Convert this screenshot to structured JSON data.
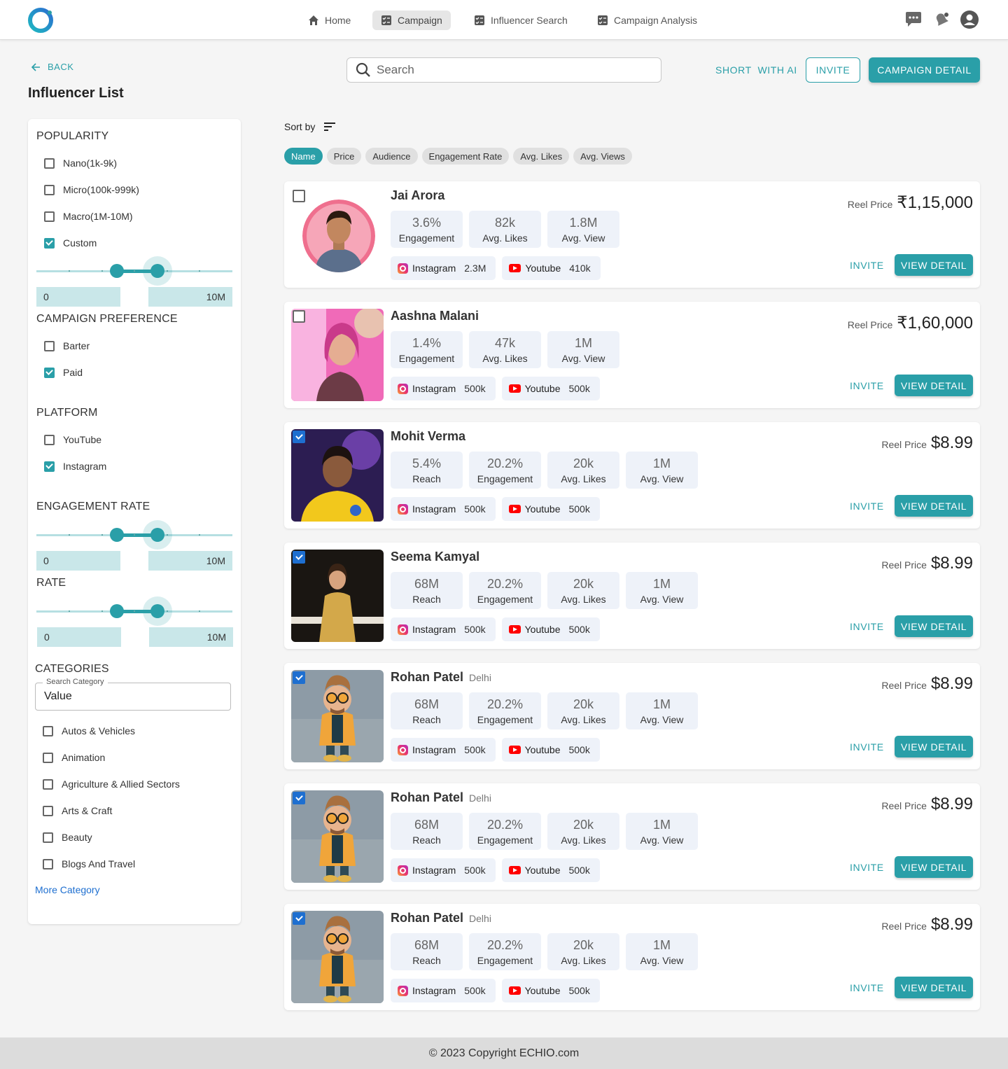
{
  "nav": {
    "items": [
      {
        "label": "Home",
        "icon": "home-icon"
      },
      {
        "label": "Campaign",
        "icon": "checklist-icon",
        "active": true
      },
      {
        "label": "Influencer Search",
        "icon": "checklist-icon"
      },
      {
        "label": "Campaign Analysis",
        "icon": "checklist-icon"
      }
    ]
  },
  "colors": {
    "accent": "#2a9fa8",
    "checkbox_blue": "#1e6fd0"
  },
  "back_label": "BACK",
  "page_title": "Influencer List",
  "search": {
    "placeholder": "Search"
  },
  "actions": {
    "short_ai": "SHORT  WITH AI",
    "invite": "INVITE",
    "campaign_detail": "CAMPAIGN DETAIL"
  },
  "filters": {
    "popularity": {
      "title": "POPULARITY",
      "options": [
        {
          "label": "Nano(1k-9k)",
          "checked": false
        },
        {
          "label": "Micro(100k-999k)",
          "checked": false
        },
        {
          "label": "Macro(1M-10M)",
          "checked": false
        },
        {
          "label": "Custom",
          "checked": true
        }
      ],
      "min": "0",
      "max": "10M"
    },
    "campaign_preference": {
      "title": "CAMPAIGN PREFERENCE",
      "options": [
        {
          "label": "Barter",
          "checked": false
        },
        {
          "label": "Paid",
          "checked": true
        }
      ]
    },
    "platform": {
      "title": "PLATFORM",
      "options": [
        {
          "label": "YouTube",
          "checked": false
        },
        {
          "label": "Instagram",
          "checked": true
        }
      ]
    },
    "engagement_rate": {
      "title": "ENGAGEMENT RATE",
      "min": "0",
      "max": "10M"
    },
    "rate": {
      "title": "RATE",
      "min": "0",
      "max": "10M"
    },
    "categories": {
      "title": "CATEGORIES",
      "search_label": "Search Category",
      "search_value": "Value",
      "options": [
        {
          "label": "Autos & Vehicles",
          "checked": false
        },
        {
          "label": "Animation",
          "checked": false
        },
        {
          "label": "Agriculture & Allied Sectors",
          "checked": false
        },
        {
          "label": "Arts & Craft",
          "checked": false
        },
        {
          "label": "Beauty",
          "checked": false
        },
        {
          "label": "Blogs And Travel",
          "checked": false
        }
      ],
      "more_label": "More Category"
    }
  },
  "sort": {
    "label": "Sort by",
    "chips": [
      "Name",
      "Price",
      "Audience",
      "Engagement Rate",
      "Avg. Likes",
      "Avg. Views"
    ],
    "active": "Name"
  },
  "influencers": [
    {
      "name": "Jai Arora",
      "city": "",
      "selected": false,
      "photo": "round",
      "stats": [
        {
          "v": "3.6%",
          "l": "Engagement"
        },
        {
          "v": "82k",
          "l": "Avg. Likes"
        },
        {
          "v": "1.8M",
          "l": "Avg. View"
        }
      ],
      "instagram": "2.3M",
      "youtube": "410k",
      "price_label": "Reel Price",
      "price": "₹1,15,000"
    },
    {
      "name": "Aashna Malani",
      "city": "",
      "selected": false,
      "photo": "pink",
      "stats": [
        {
          "v": "1.4%",
          "l": "Engagement"
        },
        {
          "v": "47k",
          "l": "Avg. Likes"
        },
        {
          "v": "1M",
          "l": "Avg. View"
        }
      ],
      "instagram": "500k",
      "youtube": "500k",
      "price_label": "Reel Price",
      "price": "₹1,60,000"
    },
    {
      "name": "Mohit Verma",
      "city": "",
      "selected": true,
      "photo": "yellow",
      "stats": [
        {
          "v": "5.4%",
          "l": "Reach"
        },
        {
          "v": "20.2%",
          "l": "Engagement"
        },
        {
          "v": "20k",
          "l": "Avg. Likes"
        },
        {
          "v": "1M",
          "l": "Avg. View"
        }
      ],
      "instagram": "500k",
      "youtube": "500k",
      "price_label": "Reel Price",
      "price": "$8.99"
    },
    {
      "name": "Seema Kamyal",
      "city": "",
      "selected": true,
      "photo": "gold",
      "stats": [
        {
          "v": "68M",
          "l": "Reach"
        },
        {
          "v": "20.2%",
          "l": "Engagement"
        },
        {
          "v": "20k",
          "l": "Avg. Likes"
        },
        {
          "v": "1M",
          "l": "Avg. View"
        }
      ],
      "instagram": "500k",
      "youtube": "500k",
      "price_label": "Reel Price",
      "price": "$8.99"
    },
    {
      "name": "Rohan Patel",
      "city": "Delhi",
      "selected": true,
      "photo": "toy",
      "stats": [
        {
          "v": "68M",
          "l": "Reach"
        },
        {
          "v": "20.2%",
          "l": "Engagement"
        },
        {
          "v": "20k",
          "l": "Avg. Likes"
        },
        {
          "v": "1M",
          "l": "Avg. View"
        }
      ],
      "instagram": "500k",
      "youtube": "500k",
      "price_label": "Reel Price",
      "price": "$8.99"
    },
    {
      "name": "Rohan Patel",
      "city": "Delhi",
      "selected": true,
      "photo": "toy",
      "stats": [
        {
          "v": "68M",
          "l": "Reach"
        },
        {
          "v": "20.2%",
          "l": "Engagement"
        },
        {
          "v": "20k",
          "l": "Avg. Likes"
        },
        {
          "v": "1M",
          "l": "Avg. View"
        }
      ],
      "instagram": "500k",
      "youtube": "500k",
      "price_label": "Reel Price",
      "price": "$8.99"
    },
    {
      "name": "Rohan Patel",
      "city": "Delhi",
      "selected": true,
      "photo": "toy",
      "stats": [
        {
          "v": "68M",
          "l": "Reach"
        },
        {
          "v": "20.2%",
          "l": "Engagement"
        },
        {
          "v": "20k",
          "l": "Avg. Likes"
        },
        {
          "v": "1M",
          "l": "Avg. View"
        }
      ],
      "instagram": "500k",
      "youtube": "500k",
      "price_label": "Reel Price",
      "price": "$8.99"
    }
  ],
  "card_labels": {
    "instagram": "Instagram",
    "youtube": "Youtube",
    "invite": "INVITE",
    "view_detail": "VIEW DETAIL"
  },
  "footer": "© 2023 Copyright ECHIO.com"
}
